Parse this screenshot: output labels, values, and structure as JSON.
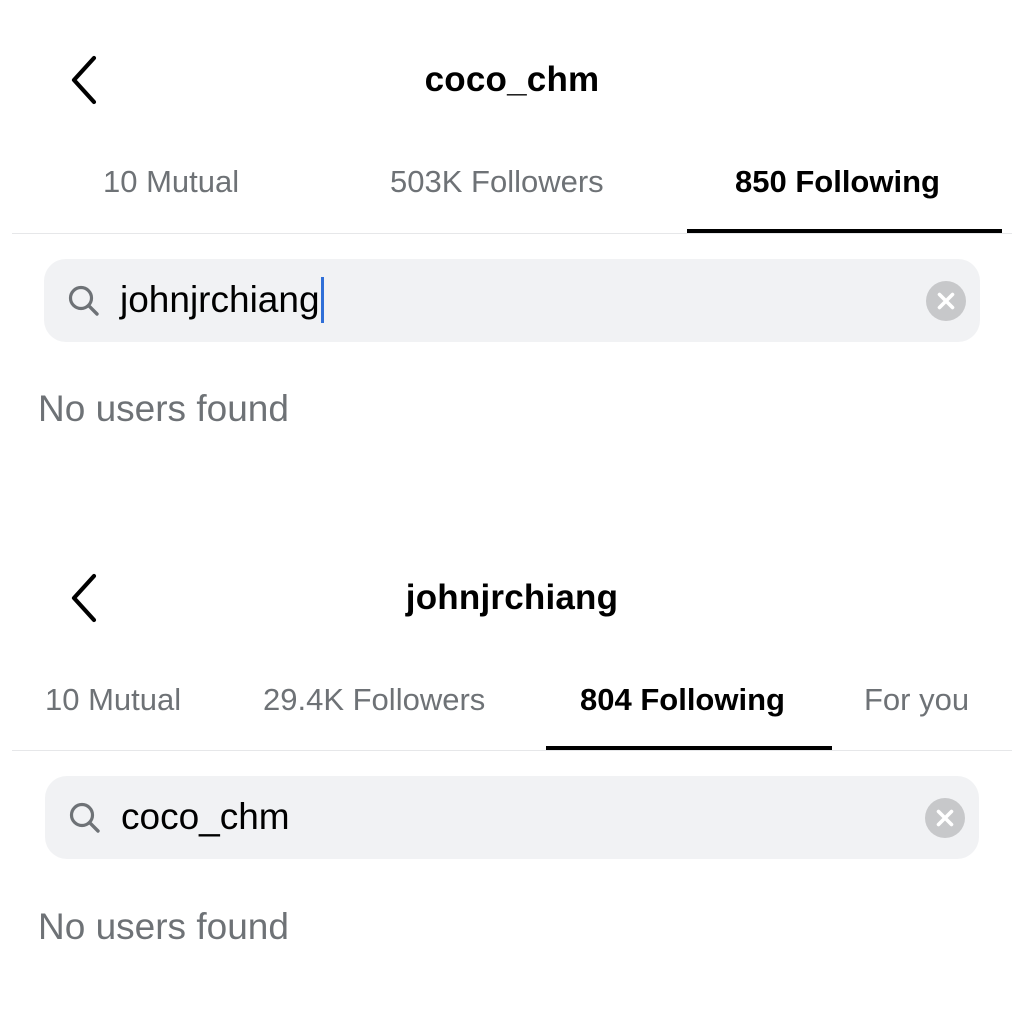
{
  "screens": [
    {
      "title": "coco_chm",
      "tabs": [
        {
          "label": "10 Mutual",
          "active": false
        },
        {
          "label": "503K Followers",
          "active": false
        },
        {
          "label": "850 Following",
          "active": true
        }
      ],
      "search": {
        "value": "johnjrchiang"
      },
      "empty_message": "No users found"
    },
    {
      "title": "johnjrchiang",
      "tabs": [
        {
          "label": "10 Mutual",
          "active": false
        },
        {
          "label": "29.4K Followers",
          "active": false
        },
        {
          "label": "804 Following",
          "active": true
        },
        {
          "label": "For you",
          "active": false
        }
      ],
      "search": {
        "value": "coco_chm"
      },
      "empty_message": "No users found"
    }
  ],
  "icons": {
    "back": "chevron-left-icon",
    "search": "search-icon",
    "clear": "clear-circle-icon"
  },
  "colors": {
    "active_tab": "#000000",
    "inactive_tab": "#6e7276",
    "search_bg": "#f1f2f4",
    "caret": "#2f6fd8"
  }
}
